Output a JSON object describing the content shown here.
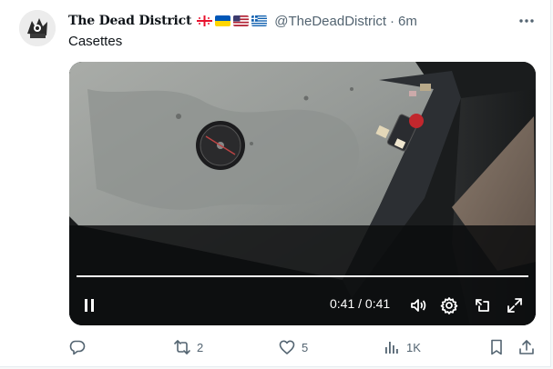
{
  "post": {
    "display_name": "The Dead District",
    "handle": "@TheDeadDistrict",
    "separator": "·",
    "time": "6m",
    "text": "Casettes",
    "flags": [
      "georgia-flag",
      "ukraine-flag",
      "usa-flag",
      "greece-flag"
    ]
  },
  "video": {
    "progress": 1.0,
    "time_readout": "0:41 / 0:41"
  },
  "actions": {
    "reply_count": "",
    "repost_count": "2",
    "like_count": "5",
    "views_count": "1K"
  },
  "colors": {
    "text_primary": "#0f1419",
    "text_secondary": "#536471",
    "video_bg": "#111111"
  }
}
